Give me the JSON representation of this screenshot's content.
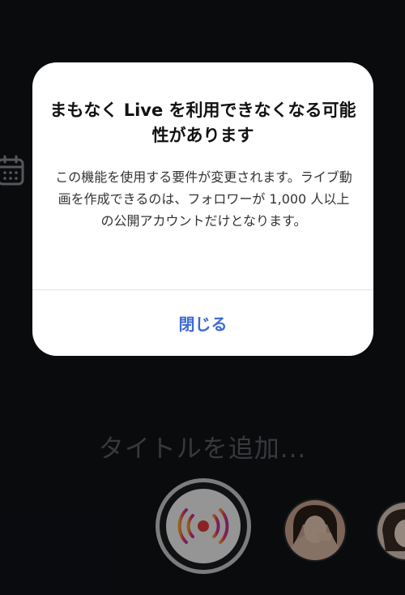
{
  "background": {
    "title_placeholder": "タイトルを追加...",
    "calendar_icon": "calendar-icon",
    "live_icon": "live-broadcast-icon"
  },
  "dialog": {
    "title": "まもなく Live を利用できなくなる可能性があります",
    "body": "この機能を使用する要件が変更されます。ライブ動画を作成できるのは、フォロワーが 1,000 人以上の公開アカウントだけとなります。",
    "close_label": "閉じる"
  },
  "colors": {
    "accent": "#3d6ad4",
    "background": "#0f1216",
    "dialog": "#ffffff"
  }
}
